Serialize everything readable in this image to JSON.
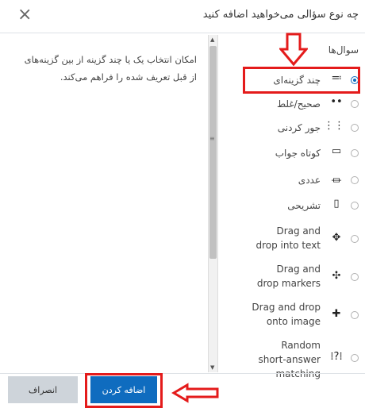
{
  "dialog": {
    "title": "چه نوع سؤالی می‌خواهید اضافه کنید",
    "close_icon": "×"
  },
  "description": "امکان انتخاب یک یا چند گزینه از بین گزینه‌های از قبل تعریف شده را فراهم می‌کند.",
  "questions_header": "سوال‌ها",
  "question_types": [
    {
      "label": "چند گزینه‌ای",
      "icon": "≔",
      "icon_name": "multichoice-icon",
      "selected": true
    },
    {
      "label": "صحیح/غلط",
      "icon": "••",
      "icon_name": "truefalse-icon",
      "selected": false
    },
    {
      "label": "جور کردنی",
      "icon": "⋮⋮",
      "icon_name": "matching-icon",
      "selected": false
    },
    {
      "label": "کوتاه جواب",
      "icon": "▭",
      "icon_name": "shortanswer-icon",
      "selected": false
    },
    {
      "label": "عددی",
      "icon": "⏛",
      "icon_name": "numerical-icon",
      "selected": false
    },
    {
      "label": "تشریحی",
      "icon": "▯",
      "icon_name": "essay-icon",
      "selected": false
    },
    {
      "label": "Drag and drop into text",
      "icon": "✥",
      "icon_name": "ddwtos-icon",
      "selected": false
    },
    {
      "label": "Drag and drop markers",
      "icon": "✣",
      "icon_name": "ddmarker-icon",
      "selected": false
    },
    {
      "label": "Drag and drop onto image",
      "icon": "✚",
      "icon_name": "ddimageortext-icon",
      "selected": false
    },
    {
      "label": "Random short-answer matching",
      "icon": "⁞?⁞",
      "icon_name": "randomsamatch-icon",
      "selected": false
    }
  ],
  "footer": {
    "add_label": "اضافه کردن",
    "cancel_label": "انصراف"
  },
  "accent_color": "#0f6cbf",
  "highlight_color": "#e41b1b"
}
